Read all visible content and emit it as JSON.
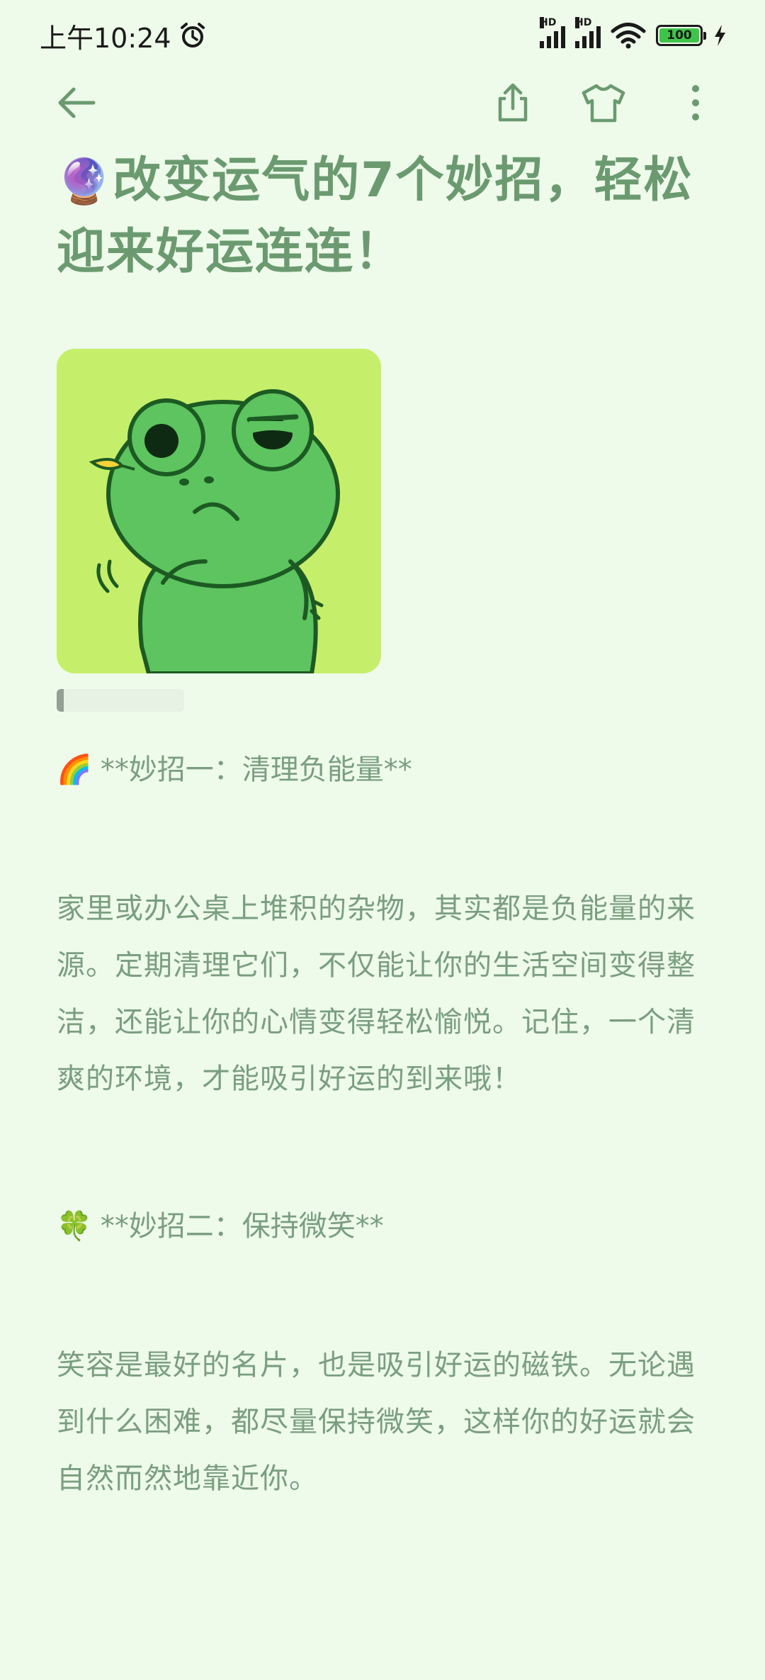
{
  "status": {
    "time": "上午10:24",
    "battery": "100"
  },
  "article": {
    "title_emoji": "🔮",
    "title": "改变运气的7个妙招，轻松迎来好运连连！",
    "sections": [
      {
        "emoji": "🌈",
        "heading": "**妙招一：清理负能量**",
        "body": "家里或办公桌上堆积的杂物，其实都是负能量的来源。定期清理它们，不仅能让你的生活空间变得整洁，还能让你的心情变得轻松愉悦。记住，一个清爽的环境，才能吸引好运的到来哦！"
      },
      {
        "emoji": "🍀",
        "heading": "**妙招二：保持微笑**",
        "body": "笑容是最好的名片，也是吸引好运的磁铁。无论遇到什么困难，都尽量保持微笑，这样你的好运就会自然而然地靠近你。"
      }
    ]
  },
  "icons": {
    "back": "arrow-left-icon",
    "share": "share-icon",
    "theme": "tshirt-icon",
    "more": "more-vertical-icon",
    "alarm": "alarm-icon",
    "wifi": "wifi-icon",
    "charging": "bolt-icon"
  },
  "colors": {
    "background": "#eefaea",
    "text": "#7a9e80",
    "title": "#6b9a70",
    "cover_bg": "#c5ef6a",
    "frog": "#5dc45f"
  }
}
